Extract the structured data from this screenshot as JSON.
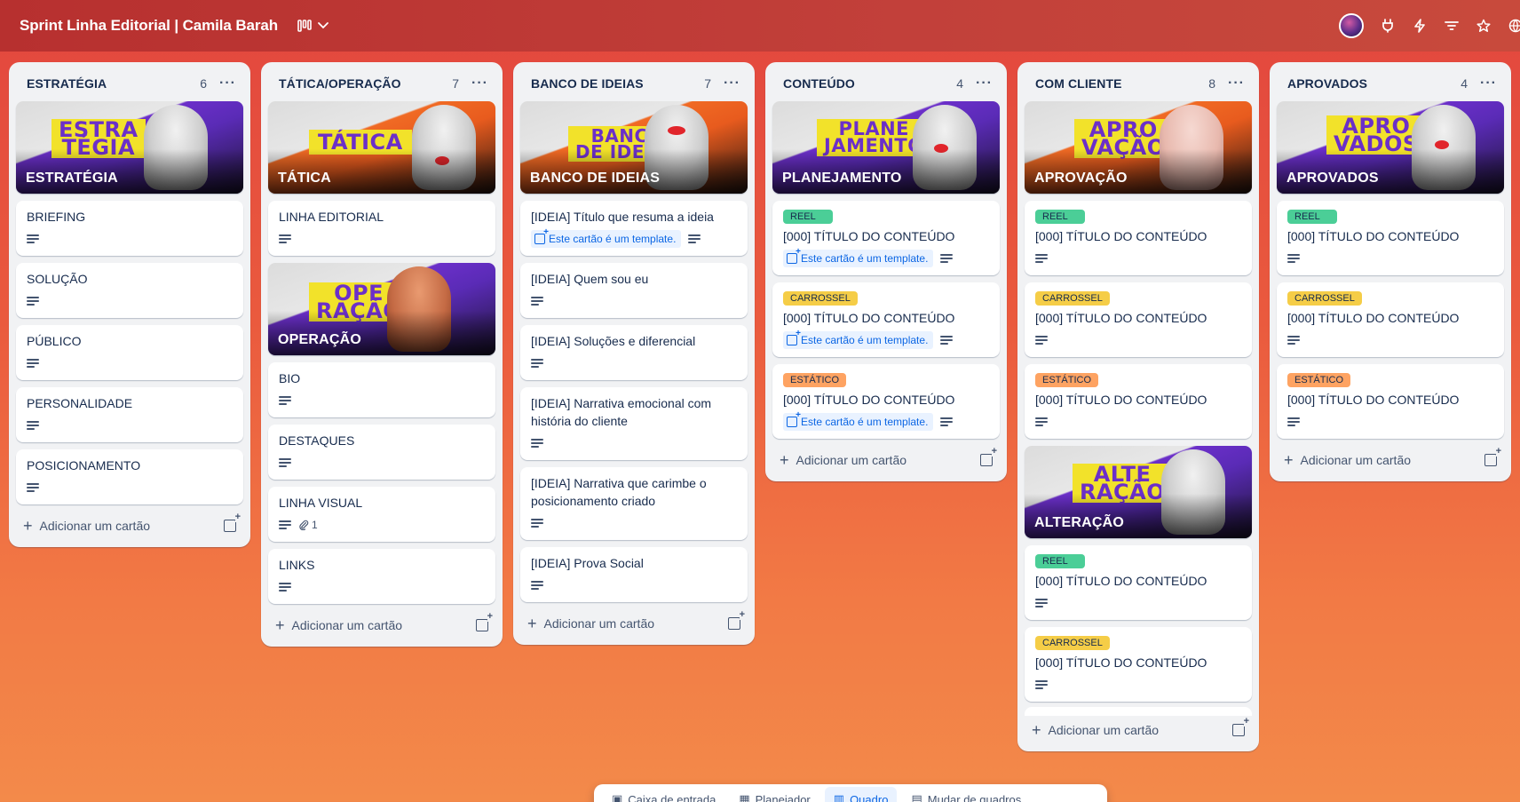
{
  "header": {
    "title": "Sprint Linha Editorial | Camila Barah",
    "view_icon": "board-view-icon",
    "icons": [
      "avatar",
      "power-up-icon",
      "automation-icon",
      "filter-icon",
      "star-icon",
      "share-icon"
    ]
  },
  "common": {
    "add_card": "Adicionar um cartão",
    "template_badge": "Este cartão é um template."
  },
  "lists": [
    {
      "title": "ESTRATÉGIA",
      "count": "6",
      "cover": {
        "title": "ESTRATÉGIA",
        "art": "ESTRA\nTÉGIA"
      },
      "cards": [
        {
          "title": "BRIEFING"
        },
        {
          "title": "SOLUÇÃO"
        },
        {
          "title": "PÚBLICO"
        },
        {
          "title": "PERSONALIDADE"
        },
        {
          "title": "POSICIONAMENTO"
        }
      ]
    },
    {
      "title": "TÁTICA/OPERAÇÃO",
      "count": "7",
      "cover": {
        "title": "TÁTICA",
        "art": "TÁTICA"
      },
      "cards": [
        {
          "title": "LINHA EDITORIAL"
        }
      ],
      "cover2": {
        "title": "OPERAÇÃO",
        "art": "OPE\nRAÇÃO"
      },
      "cards2": [
        {
          "title": "BIO"
        },
        {
          "title": "DESTAQUES"
        },
        {
          "title": "LINHA VISUAL",
          "attachments": "1"
        },
        {
          "title": "LINKS"
        }
      ]
    },
    {
      "title": "BANCO DE IDEIAS",
      "count": "7",
      "cover": {
        "title": "BANCO DE IDEIAS",
        "art": "BANCO\nDE IDEIAS"
      },
      "cards": [
        {
          "title": "[IDEIA] Título que resuma a ideia"
        },
        {
          "title": "[IDEIA] Quem sou eu"
        },
        {
          "title": "[IDEIA] Soluções e diferencial"
        },
        {
          "title": "[IDEIA] Narrativa emocional com história do cliente"
        },
        {
          "title": "[IDEIA] Narrativa que carimbe o posicionamento criado"
        },
        {
          "title": "[IDEIA] Prova Social"
        }
      ]
    },
    {
      "title": "CONTEÚDO",
      "count": "4",
      "cover": {
        "title": "PLANEJAMENTO",
        "art": "PLANE\nJAMENTO"
      },
      "cards": [
        {
          "label": "REEL",
          "title": "[000] TÍTULO DO CONTEÚDO"
        },
        {
          "label": "CARROSSEL",
          "title": "[000] TÍTULO DO CONTEÚDO"
        },
        {
          "label": "ESTÁTICO",
          "title": "[000] TÍTULO DO CONTEÚDO"
        }
      ]
    },
    {
      "title": "COM CLIENTE",
      "count": "8",
      "cover": {
        "title": "APROVAÇÃO",
        "art": "APRO\nVAÇÃO"
      },
      "cards": [
        {
          "label": "REEL",
          "title": "[000] TÍTULO DO CONTEÚDO"
        },
        {
          "label": "CARROSSEL",
          "title": "[000] TÍTULO DO CONTEÚDO"
        },
        {
          "label": "ESTÁTICO",
          "title": "[000] TÍTULO DO CONTEÚDO"
        }
      ],
      "cover2": {
        "title": "ALTERAÇÃO",
        "art": "ALTE\nRAÇÃO"
      },
      "cards2": [
        {
          "label": "REEL",
          "title": "[000] TÍTULO DO CONTEÚDO"
        },
        {
          "label": "CARROSSEL",
          "title": "[000] TÍTULO DO CONTEÚDO"
        }
      ]
    },
    {
      "title": "APROVADOS",
      "count": "4",
      "cover": {
        "title": "APROVADOS",
        "art": "APRO\nVADOS"
      },
      "cards": [
        {
          "label": "REEL",
          "title": "[000] TÍTULO DO CONTEÚDO"
        },
        {
          "label": "CARROSSEL",
          "title": "[000] TÍTULO DO CONTEÚDO"
        },
        {
          "label": "ESTÁTICO",
          "title": "[000] TÍTULO DO CONTEÚDO"
        }
      ]
    }
  ],
  "label_colors": {
    "REEL": "#4bce97",
    "CARROSSEL": "#f5cd47",
    "ESTÁTICO": "#fea362"
  },
  "bottom_bar": {
    "items": [
      {
        "label": "Caixa de entrada"
      },
      {
        "label": "Planejador"
      },
      {
        "label": "Quadro",
        "active": true
      },
      {
        "label": "Mudar de quadros"
      }
    ]
  }
}
